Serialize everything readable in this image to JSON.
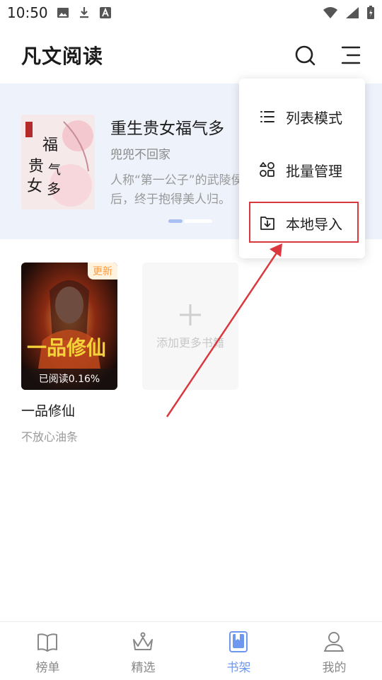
{
  "status_bar": {
    "time": "10:50"
  },
  "app": {
    "title": "凡文阅读"
  },
  "banner": {
    "book_title": "重生贵女福气多",
    "author": "兜兜不回家",
    "description_line1": "人称“第一公子”的武陵侯",
    "description_line2": "后，终于抱得美人归。",
    "cover_text": "福气多"
  },
  "bookshelf": {
    "books": [
      {
        "title": "一品修仙",
        "author": "不放心油条",
        "badge": "更新",
        "progress_text": "已阅读0.16%",
        "cover_text": "一品修仙"
      }
    ],
    "add_more_label": "添加更多书籍"
  },
  "menu": {
    "items": [
      {
        "label": "列表模式",
        "icon": "list-icon"
      },
      {
        "label": "批量管理",
        "icon": "grid-icon"
      },
      {
        "label": "本地导入",
        "icon": "import-icon"
      }
    ]
  },
  "bottom_nav": {
    "items": [
      {
        "label": "榜单",
        "icon": "book-open-icon"
      },
      {
        "label": "精选",
        "icon": "crown-icon"
      },
      {
        "label": "书架",
        "icon": "bookshelf-icon",
        "active": true
      },
      {
        "label": "我的",
        "icon": "user-icon"
      }
    ]
  },
  "colors": {
    "accent": "#6e98ef",
    "highlight": "#d9383e",
    "banner_bg": "#eef2fb"
  }
}
